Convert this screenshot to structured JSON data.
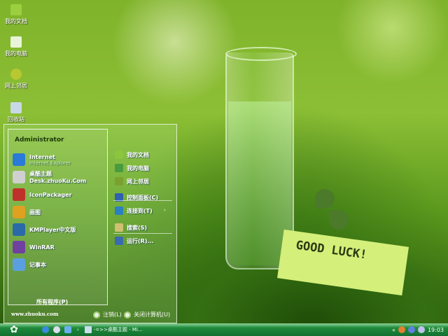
{
  "desktop": {
    "icons": [
      {
        "label": "我的文档",
        "icon": "my-documents-icon"
      },
      {
        "label": "我的电脑",
        "icon": "my-computer-icon"
      },
      {
        "label": "网上邻居",
        "icon": "network-places-icon"
      },
      {
        "label": "回收站",
        "icon": "recycle-bin-icon"
      }
    ],
    "wallpaper_note": "GOOD LUCK!"
  },
  "start_menu": {
    "user": "Administrator",
    "programs": [
      {
        "label": "Internet",
        "sub": "Internet Explorer",
        "icon": "internet-explorer-icon",
        "color": "#2a7ad8"
      },
      {
        "label": "桌酷主题Desk.zhuoKu.Com",
        "icon": "zhuoku-theme-icon",
        "color": "#d0d0d0"
      },
      {
        "label": "IconPackager",
        "icon": "iconpackager-icon",
        "color": "#c0302a"
      },
      {
        "label": "画图",
        "icon": "paint-icon",
        "color": "#e0a020"
      },
      {
        "label": "KMPlayer中文版",
        "icon": "kmplayer-icon",
        "color": "#2a6aa8"
      },
      {
        "label": "WinRAR",
        "icon": "winrar-icon",
        "color": "#7040a0"
      },
      {
        "label": "记事本",
        "icon": "notepad-icon",
        "color": "#5aa0e0"
      }
    ],
    "all_programs": "所有程序(P)",
    "places": [
      {
        "label": "我的文档",
        "icon": "my-documents-icon",
        "color": "#8cc63f"
      },
      {
        "label": "我的电脑",
        "icon": "my-computer-icon",
        "color": "#4a9a40"
      },
      {
        "label": "网上邻居",
        "icon": "network-places-icon",
        "color": "#7aa030"
      },
      {
        "label": "控制面板(C)",
        "icon": "control-panel-icon",
        "color": "#3060b0"
      },
      {
        "label": "连接到(T)",
        "icon": "connect-to-icon",
        "color": "#2a80c0",
        "arrow": "›"
      },
      {
        "label": "搜索(S)",
        "icon": "search-icon",
        "color": "#d0c070"
      },
      {
        "label": "运行(R)...",
        "icon": "run-icon",
        "color": "#3a6ab0"
      }
    ],
    "website": "www.zhuoku.com",
    "logoff": "注销(L)",
    "shutdown": "关闭计算机(U)"
  },
  "taskbar": {
    "quick_launch": [
      "internet-explorer-icon",
      "media-icon",
      "desktop-icon"
    ],
    "chevron": "›",
    "task": "-=>>桌酷主题 - Mi...",
    "clock": "19:03"
  }
}
